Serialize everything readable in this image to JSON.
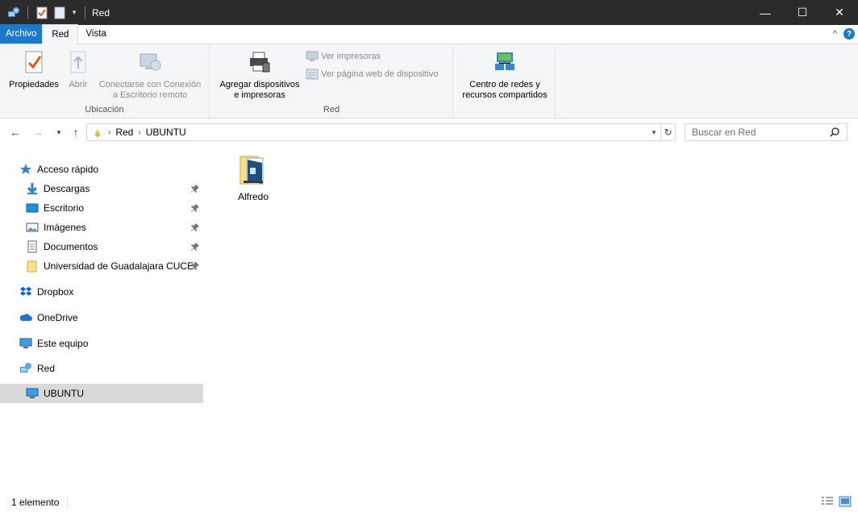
{
  "window": {
    "title": "Red",
    "minimize_glyph": "—",
    "maximize_glyph": "☐",
    "close_glyph": "✕"
  },
  "tabs": {
    "file": "Archivo",
    "red": "Red",
    "vista": "Vista",
    "help_glyph": "?",
    "collapse_glyph": "^"
  },
  "ribbon": {
    "ubicacion": {
      "label": "Ubicación",
      "propiedades": "Propiedades",
      "abrir": "Abrir",
      "conectar_line1": "Conectarse con Conexión",
      "conectar_line2": "a Escritorio remoto"
    },
    "red": {
      "label": "Red",
      "agregar_line1": "Agregar dispositivos",
      "agregar_line2": "e impresoras",
      "ver_impresoras": "Ver impresoras",
      "ver_pagina": "Ver página web de dispositivo"
    },
    "centro": {
      "line1": "Centro de redes y",
      "line2": "recursos compartidos"
    }
  },
  "address": {
    "crumbs": [
      "Red",
      "UBUNTU"
    ],
    "search_placeholder": "Buscar en Red"
  },
  "sidebar": {
    "quick_access": "Acceso rápido",
    "items": [
      {
        "label": "Descargas",
        "icon": "download-arrow-icon"
      },
      {
        "label": "Escritorio",
        "icon": "desktop-icon"
      },
      {
        "label": "Imágenes",
        "icon": "pictures-icon"
      },
      {
        "label": "Documentos",
        "icon": "documents-icon"
      },
      {
        "label": "Universidad de Guadalajara CUCEI",
        "icon": "folder-icon"
      }
    ],
    "dropbox": "Dropbox",
    "onedrive": "OneDrive",
    "este_equipo": "Este equipo",
    "red": "Red",
    "ubuntu": "UBUNTU"
  },
  "content": {
    "items": [
      {
        "label": "Alfredo",
        "icon": "network-share-folder-icon"
      }
    ]
  },
  "status": {
    "count": "1 elemento"
  },
  "colors": {
    "titlebar": "#2b2b2b",
    "file_tab": "#1979ca",
    "ribbon_bg": "#f5f6f7",
    "selection": "#d9d9d9"
  }
}
